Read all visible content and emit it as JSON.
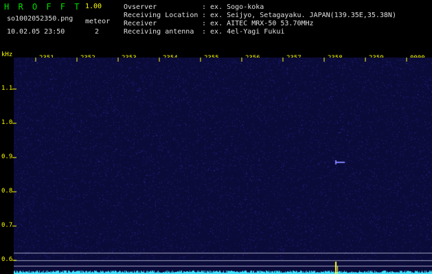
{
  "app": {
    "name": "H R O F F T",
    "version": "1.00"
  },
  "file": {
    "name": "so1002052350.png",
    "datetime": "10.02.05 23:50",
    "count_label": "meteor",
    "count": "2"
  },
  "info": {
    "observer_label": "Ovserver",
    "observer_value": ": ex. Sogo-koka",
    "location_label": "Receiving Location",
    "location_value": ": ex. Seijyo, Setagayaku. JAPAN(139.35E,35.38N)",
    "receiver_label": "Receiver",
    "receiver_value": ": ex. AITEC MRX-50 53.70MHz",
    "antenna_label": "Receiving antenna",
    "antenna_value": ": ex. 4el-Yagi Fukui"
  },
  "axis": {
    "unit": "kHz",
    "time_labels": [
      "2351",
      "2352",
      "2353",
      "2354",
      "2355",
      "2356",
      "2357",
      "2358",
      "2359",
      "0000"
    ],
    "freq_labels": [
      "1.1",
      "1.0",
      "0.9",
      "0.8",
      "0.7",
      "0.6"
    ]
  },
  "colors": {
    "background": "#000000",
    "spectrogram": "#0b0b3a",
    "text_yellow": "#ffff00",
    "text_green": "#00e000",
    "signal": "#40e0ff",
    "meteor": "#ffff40"
  },
  "chart_data": {
    "type": "heatmap",
    "xlabel": "",
    "ylabel": "kHz",
    "x_ticks": [
      "2351",
      "2352",
      "2353",
      "2354",
      "2355",
      "2356",
      "2357",
      "2358",
      "2359",
      "0000"
    ],
    "y_ticks": [
      1.1,
      1.0,
      0.9,
      0.8,
      0.7,
      0.6
    ],
    "meteors": [
      {
        "time": "2358",
        "freq_khz": 0.89
      }
    ]
  }
}
